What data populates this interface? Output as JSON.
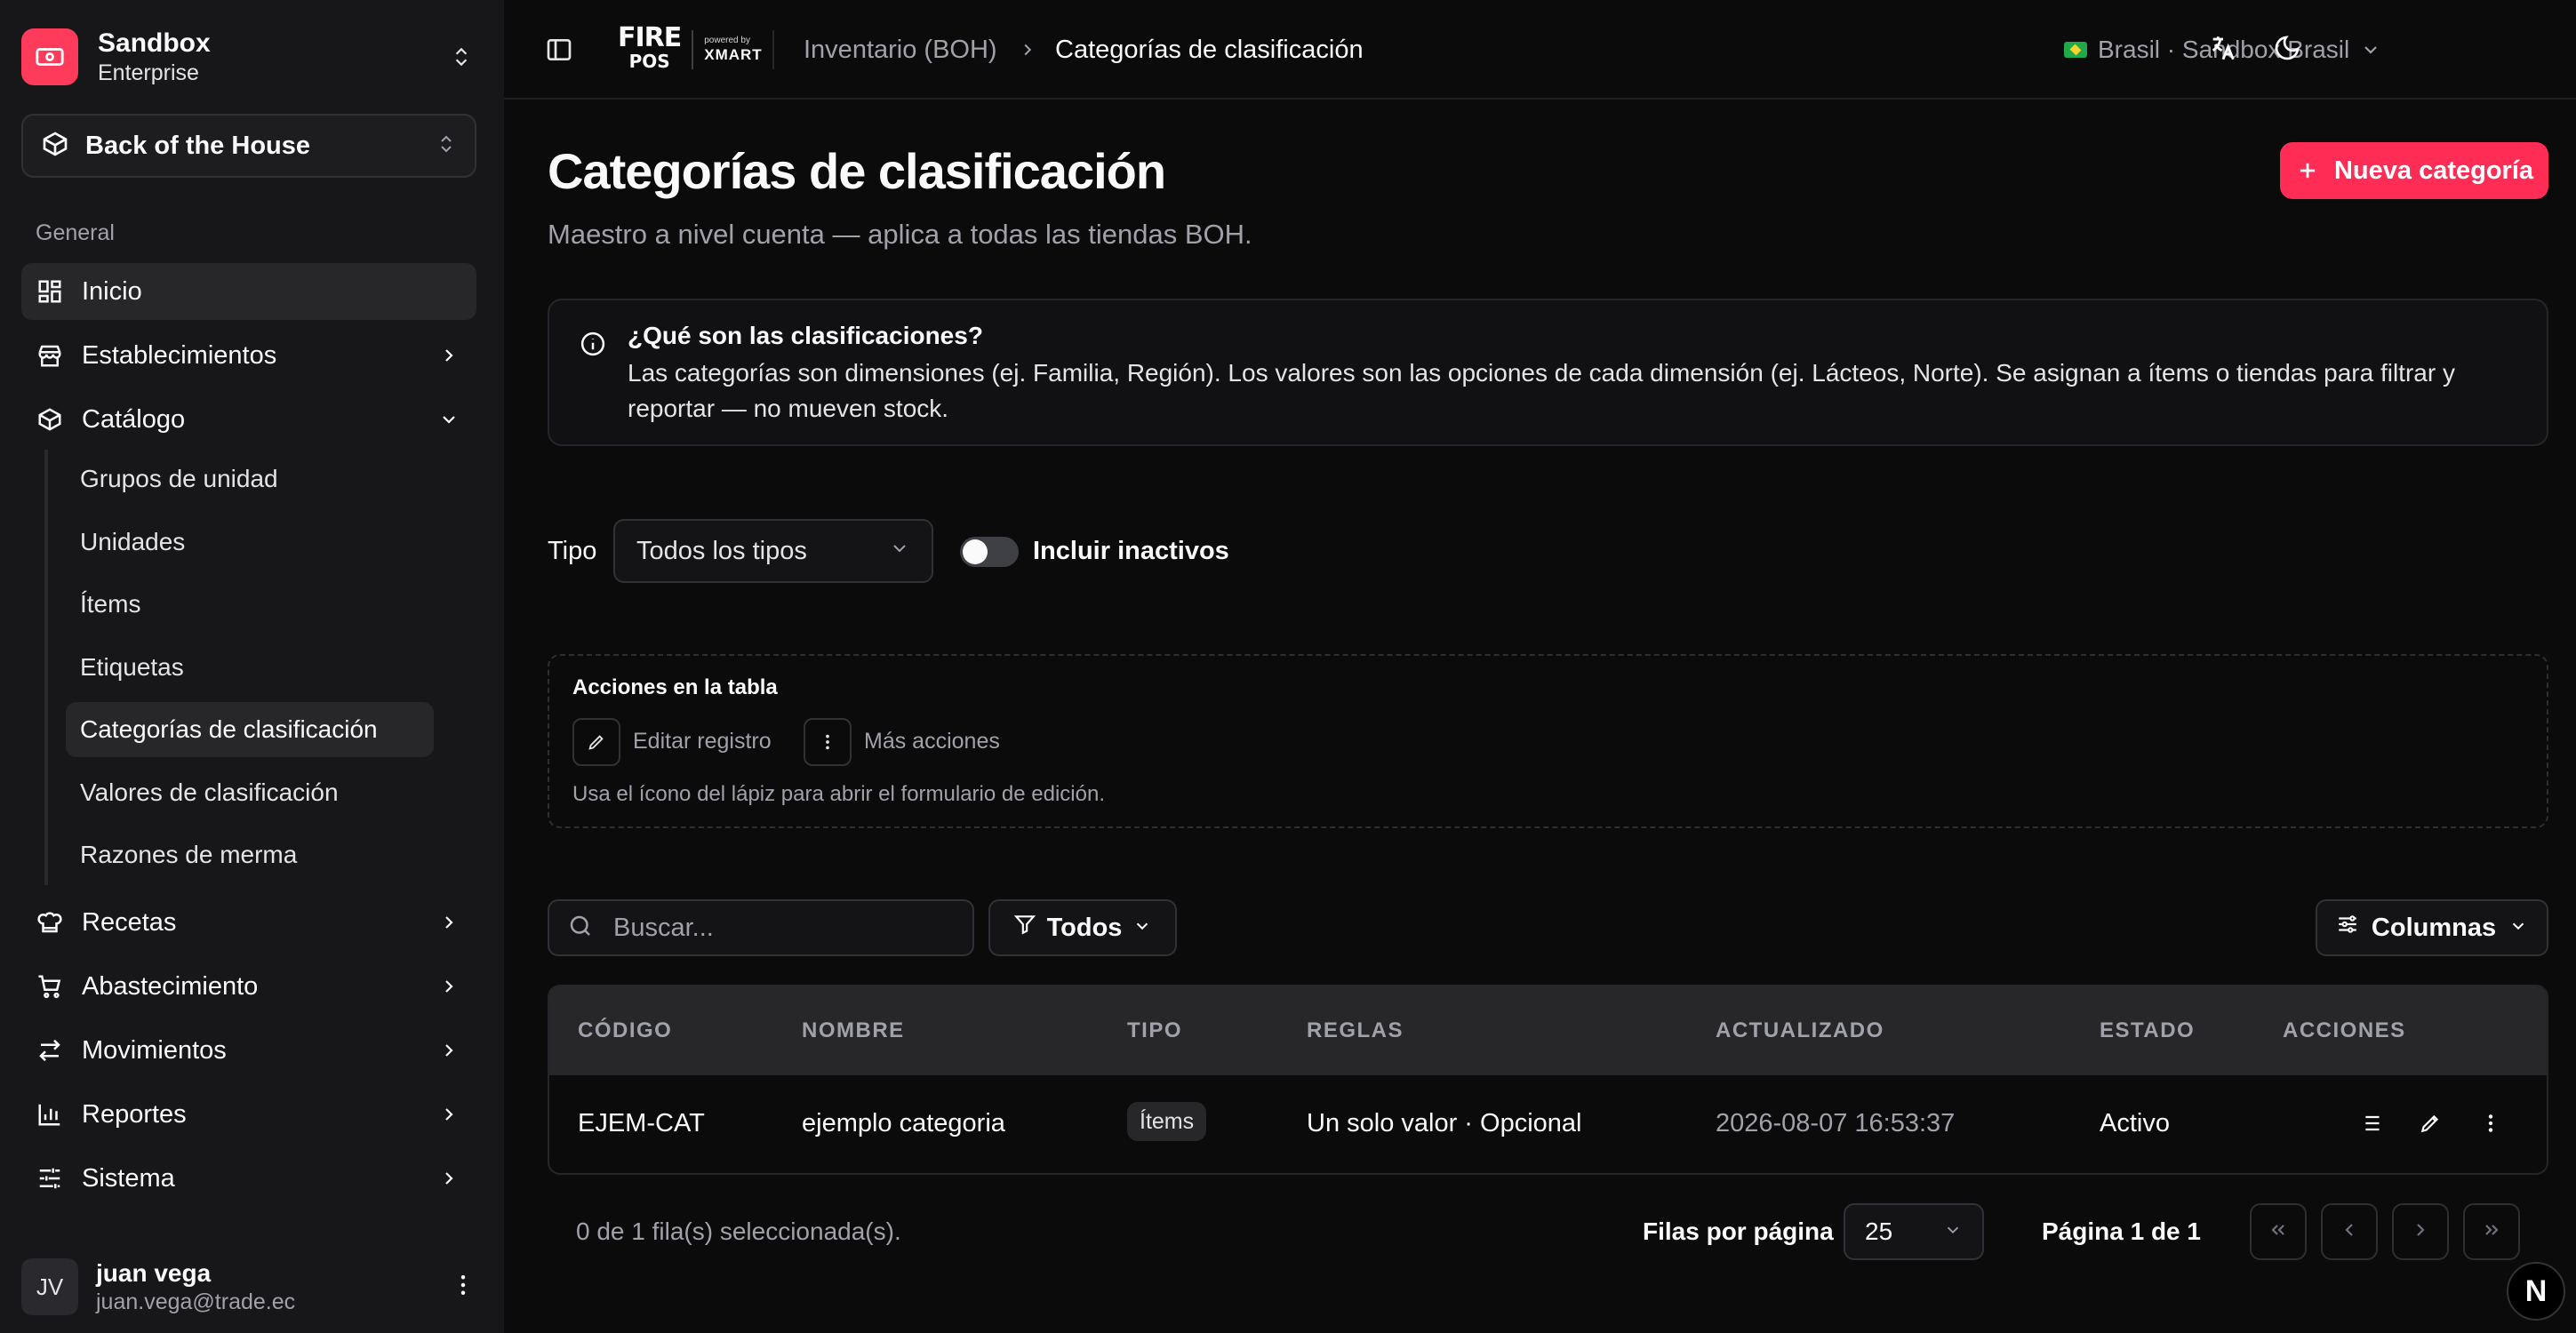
{
  "sidebar": {
    "team": {
      "name": "Sandbox",
      "plan": "Enterprise"
    },
    "module": {
      "label": "Back of the House"
    },
    "group_label": "General",
    "items": {
      "inicio": "Inicio",
      "establecimientos": "Establecimientos",
      "catalogo": "Catálogo",
      "recetas": "Recetas",
      "abastecimiento": "Abastecimiento",
      "movimientos": "Movimientos",
      "reportes": "Reportes",
      "sistema": "Sistema"
    },
    "catalog_subitems": [
      "Grupos de unidad",
      "Unidades",
      "Ítems",
      "Etiquetas",
      "Categorías de clasificación",
      "Valores de clasificación",
      "Razones de merma"
    ],
    "active_subitem": "Categorías de clasificación",
    "user": {
      "initials": "JV",
      "name": "juan vega",
      "email": "juan.vega@trade.ec"
    }
  },
  "topbar": {
    "brand": {
      "fire": "FIRE",
      "pos": "POS",
      "powered": "powered by",
      "xmart": "XMART"
    },
    "breadcrumb": [
      "Inventario (BOH)",
      "Categorías de clasificación"
    ],
    "region": "Brasil · Sandbox Brasil"
  },
  "page": {
    "title": "Categorías de clasificación",
    "subtitle": "Maestro a nivel cuenta — aplica a todas las tiendas BOH.",
    "new_button": "Nueva categoría"
  },
  "info": {
    "title": "¿Qué son las clasificaciones?",
    "body": "Las categorías son dimensiones (ej. Familia, Región). Los valores son las opciones de cada dimensión (ej. Lácteos, Norte). Se asignan a ítems o tiendas para filtrar y reportar — no mueven stock."
  },
  "filters": {
    "type_label": "Tipo",
    "type_value": "Todos los tipos",
    "include_inactive_label": "Incluir inactivos",
    "include_inactive": false
  },
  "table_actions": {
    "title": "Acciones en la tabla",
    "edit_label": "Editar registro",
    "more_label": "Más acciones",
    "hint": "Usa el ícono del lápiz para abrir el formulario de edición."
  },
  "toolbar": {
    "search_placeholder": "Buscar...",
    "filter_label": "Todos",
    "columns_label": "Columnas"
  },
  "table": {
    "headers": [
      "CÓDIGO",
      "NOMBRE",
      "TIPO",
      "REGLAS",
      "ACTUALIZADO",
      "ESTADO",
      "ACCIONES"
    ],
    "rows": [
      {
        "codigo": "EJEM-CAT",
        "nombre": "ejemplo categoria",
        "tipo": "Ítems",
        "reglas": "Un solo valor · Opcional",
        "actualizado": "2026-08-07 16:53:37",
        "estado": "Activo"
      }
    ]
  },
  "pagination": {
    "selected": "0 de 1 fila(s) seleccionada(s).",
    "rows_per_page_label": "Filas por página",
    "rows_per_page": "25",
    "page_info": "Página 1 de 1"
  },
  "colors": {
    "accent": "#ff2d55",
    "background": "#0b0b0c",
    "sidebar": "#171719"
  }
}
